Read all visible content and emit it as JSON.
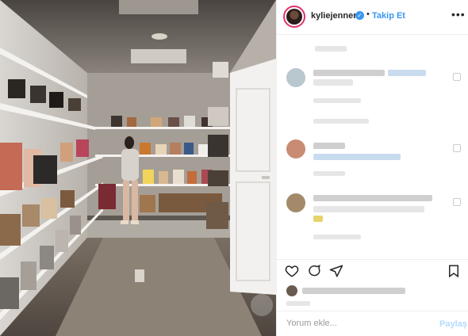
{
  "header": {
    "username": "kyliejenner",
    "verified_glyph": "✓",
    "separator": "•",
    "follow_label": "Takip Et",
    "more_label": "•••"
  },
  "comment_box": {
    "placeholder": "Yorum ekle...",
    "share_label": "Paylaş"
  },
  "icons": [
    "verified-badge-icon",
    "more-options-icon",
    "heart-icon",
    "comment-icon",
    "share-icon",
    "bookmark-icon"
  ],
  "colors": {
    "accent": "#3897f0",
    "story_ring": "#e2336b",
    "share_disabled": "#b3dbff"
  }
}
